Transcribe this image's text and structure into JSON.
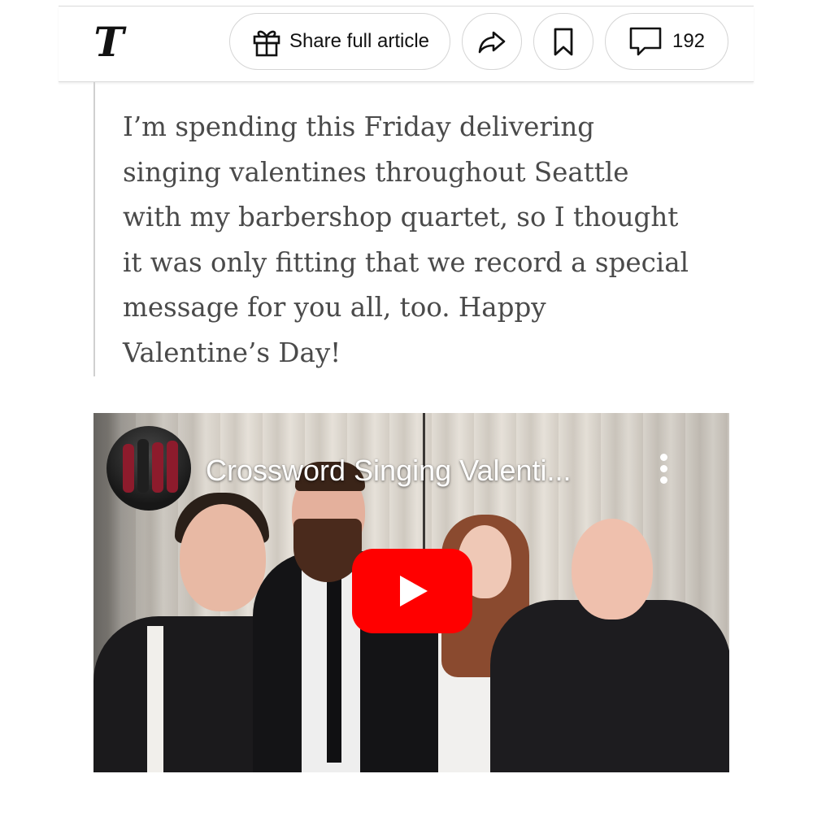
{
  "toolbar": {
    "logo_glyph": "T",
    "share_label": "Share full article",
    "comment_count": "192",
    "icons": [
      "gift-icon",
      "share-arrow-icon",
      "bookmark-icon",
      "comment-icon"
    ]
  },
  "article": {
    "quote": "I’m spending this Friday delivering singing valentines throughout Seattle with my barbershop quartet, so I thought it was only fitting that we record a special message for you all, too. Happy Valentine’s Day!"
  },
  "video": {
    "title": "Crossword Singing Valenti...",
    "play_color": "#ff0000",
    "icons": [
      "channel-avatar",
      "more-options-icon",
      "play-icon"
    ]
  }
}
